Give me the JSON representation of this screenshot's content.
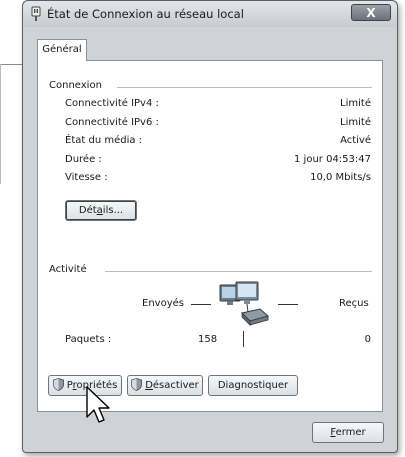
{
  "window": {
    "title": "État de Connexion au réseau local",
    "close_glyph": "X"
  },
  "tabs": [
    {
      "label": "Général"
    }
  ],
  "connexion": {
    "header": "Connexion",
    "rows": [
      {
        "label": "Connectivité IPv4 :",
        "value": "Limité"
      },
      {
        "label": "Connectivité IPv6 :",
        "value": "Limité"
      },
      {
        "label": "État du média :",
        "value": "Activé"
      },
      {
        "label": "Durée :",
        "value": "1 jour 04:53:47"
      },
      {
        "label": "Vitesse :",
        "value": "10,0 Mbits/s"
      }
    ],
    "details_button": {
      "before": "Dét",
      "accel": "a",
      "after": "ils..."
    }
  },
  "activite": {
    "header": "Activité",
    "sent_label": "Envoyés",
    "received_label": "Reçus",
    "packets_label": "Paquets :",
    "packets_sent": "158",
    "packets_received": "0",
    "icon": "network-computers-icon"
  },
  "actions": {
    "proprietes": {
      "before": "P",
      "accel": "r",
      "after": "opriétés",
      "icon": "shield-icon"
    },
    "desactiver": {
      "before": "",
      "accel": "D",
      "after": "ésactiver",
      "icon": "shield-icon"
    },
    "diagnostiquer": {
      "label": "Diagnostiquer"
    }
  },
  "footer": {
    "fermer": {
      "before": "",
      "accel": "F",
      "after": "ermer"
    }
  },
  "colors": {
    "window_frame": "#cfd3d7",
    "panel": "#ffffff",
    "border": "#8c9096"
  },
  "cursor": "arrow-cursor"
}
